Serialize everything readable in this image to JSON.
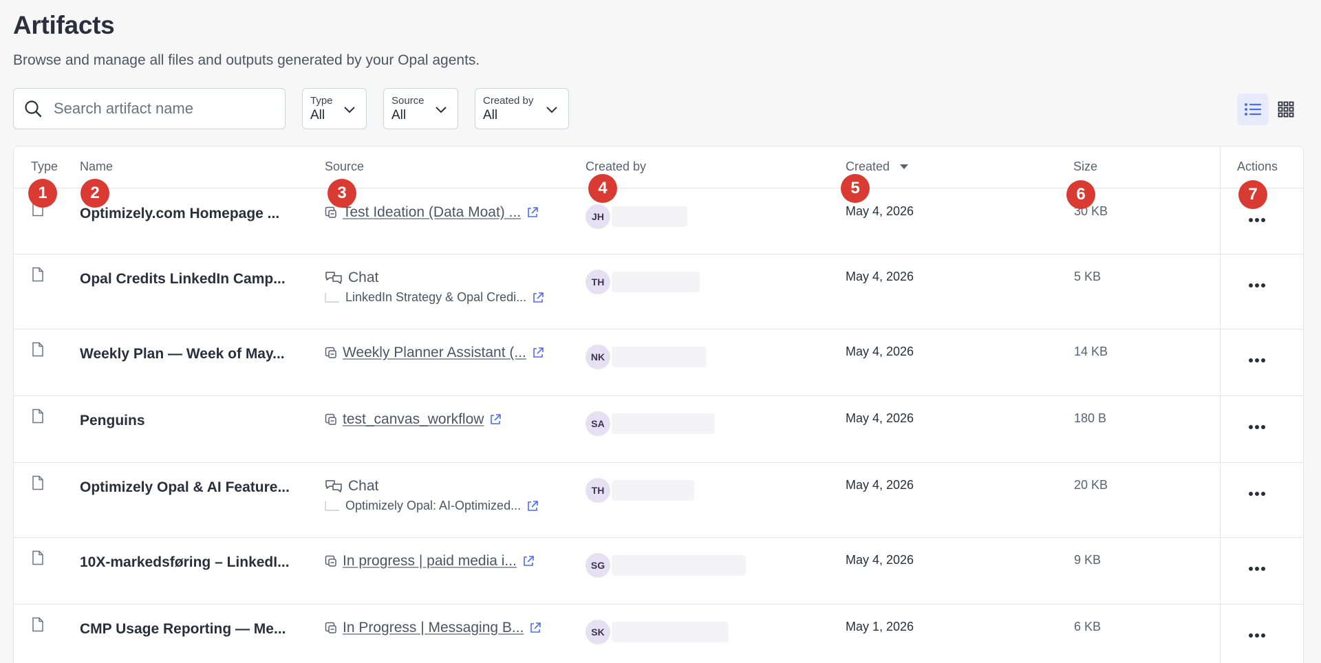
{
  "page": {
    "title": "Artifacts",
    "subtitle": "Browse and manage all files and outputs generated by your Opal agents."
  },
  "search": {
    "placeholder": "Search artifact name",
    "icon": "search-icon"
  },
  "filters": [
    {
      "label": "Type",
      "value": "All"
    },
    {
      "label": "Source",
      "value": "All"
    },
    {
      "label": "Created by",
      "value": "All"
    }
  ],
  "view_toggle": {
    "active": "list",
    "icons": [
      "list-view-icon",
      "grid-view-icon"
    ]
  },
  "columns": [
    "Type",
    "Name",
    "Source",
    "Created by",
    "Created",
    "Size",
    "Actions"
  ],
  "sort": {
    "column": "Created",
    "direction": "descending"
  },
  "rows": [
    {
      "name": "Optimizely.com Homepage ...",
      "source_kind": "workflow",
      "source": "Test Ideation (Data Moat) ...",
      "source_sub": "",
      "initials": "JH",
      "created": "May 4, 2026",
      "size": "30 KB"
    },
    {
      "name": "Opal Credits LinkedIn Camp...",
      "source_kind": "chat",
      "source": "Chat",
      "source_sub": "LinkedIn Strategy & Opal Credi...",
      "initials": "TH",
      "created": "May 4, 2026",
      "size": "5 KB"
    },
    {
      "name": "Weekly Plan — Week of May...",
      "source_kind": "workflow",
      "source": "Weekly Planner Assistant (...",
      "source_sub": "",
      "initials": "NK",
      "created": "May 4, 2026",
      "size": "14 KB"
    },
    {
      "name": "Penguins",
      "source_kind": "workflow",
      "source": "test_canvas_workflow",
      "source_sub": "",
      "initials": "SA",
      "created": "May 4, 2026",
      "size": "180 B"
    },
    {
      "name": "Optimizely Opal & AI Feature...",
      "source_kind": "chat",
      "source": "Chat",
      "source_sub": "Optimizely Opal: AI-Optimized...",
      "initials": "TH",
      "created": "May 4, 2026",
      "size": "20 KB"
    },
    {
      "name": "10X-markedsføring – LinkedI...",
      "source_kind": "workflow",
      "source": "In progress | paid media i...",
      "source_sub": "",
      "initials": "SG",
      "created": "May 4, 2026",
      "size": "9 KB"
    },
    {
      "name": "CMP Usage Reporting — Me...",
      "source_kind": "workflow",
      "source": "In Progress | Messaging B...",
      "source_sub": "",
      "initials": "SK",
      "created": "May 1, 2026",
      "size": "6 KB"
    }
  ],
  "markers": [
    "1",
    "2",
    "3",
    "4",
    "5",
    "6",
    "7"
  ],
  "colors": {
    "accent": "#4a6cf7",
    "marker": "#d93b33",
    "avatar_bg": "#e6e0f3",
    "active_view_bg": "#e7ebfb"
  }
}
